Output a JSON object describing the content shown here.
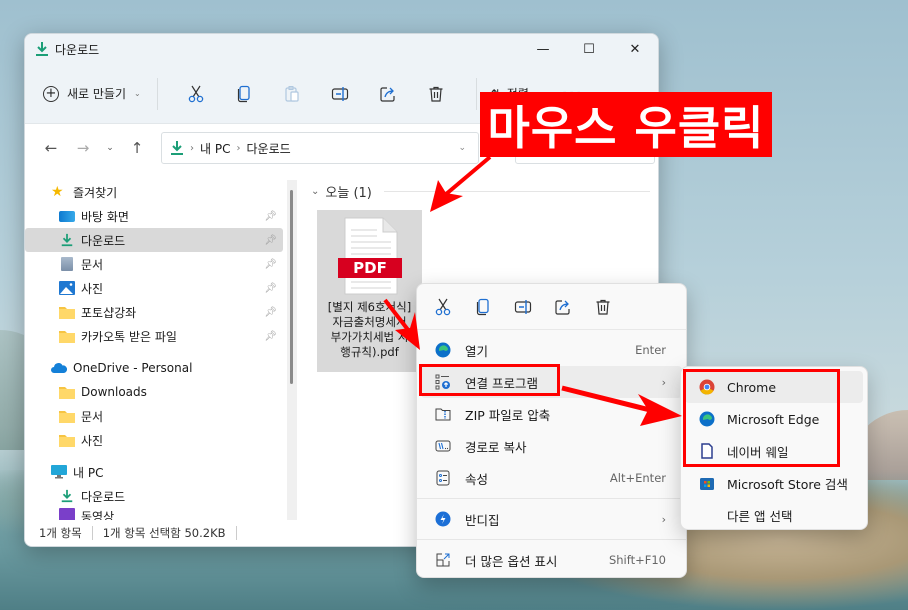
{
  "window": {
    "title": "다운로드",
    "controls": {
      "minimize": "—",
      "maximize": "☐",
      "close": "✕"
    }
  },
  "toolbar": {
    "new_label": "새로 만들기",
    "sort_label": "정렬",
    "more_label": "···",
    "icons": [
      "cut-icon",
      "copy-icon",
      "paste-icon",
      "rename-icon",
      "share-icon",
      "delete-icon"
    ]
  },
  "navbar": {
    "breadcrumb": [
      "내 PC",
      "다운로드"
    ],
    "separator": "›"
  },
  "sidebar": {
    "favorites_label": "즐겨찾기",
    "quick_access": [
      {
        "label": "바탕 화면",
        "icon": "desktop-icon",
        "pinned": true
      },
      {
        "label": "다운로드",
        "icon": "download-icon",
        "pinned": true,
        "selected": true
      },
      {
        "label": "문서",
        "icon": "document-icon",
        "pinned": true
      },
      {
        "label": "사진",
        "icon": "pictures-icon",
        "pinned": true
      },
      {
        "label": "포토샵강좌",
        "icon": "folder-icon",
        "pinned": true
      },
      {
        "label": "카카오톡 받은 파일",
        "icon": "folder-icon",
        "pinned": true
      }
    ],
    "onedrive_label": "OneDrive - Personal",
    "onedrive_items": [
      {
        "label": "Downloads",
        "icon": "folder-icon"
      },
      {
        "label": "문서",
        "icon": "folder-icon"
      },
      {
        "label": "사진",
        "icon": "folder-icon"
      }
    ],
    "pc_label": "내 PC",
    "pc_items": [
      {
        "label": "다운로드",
        "icon": "download-icon"
      },
      {
        "label": "동영상",
        "icon": "video-icon"
      }
    ]
  },
  "files": {
    "group_label": "오늘 (1)",
    "items": [
      {
        "name": "[별지 제6호서식] 자금출처명세서(부가가치세법 시행규칙).pdf",
        "display_lines": [
          "[별지 제6호서식]",
          "자금출처명세서",
          "부가가치세법 시",
          "행규칙).pdf"
        ],
        "badge": "PDF"
      }
    ]
  },
  "statusbar": {
    "item_count": "1개 항목",
    "selection": "1개 항목 선택함 50.2KB"
  },
  "context_menu": {
    "items": [
      {
        "label": "열기",
        "shortcut": "Enter",
        "icon": "edge-icon"
      },
      {
        "label": "연결 프로그램",
        "submenu": true,
        "icon": "open-with-icon",
        "highlighted": true
      },
      {
        "label": "ZIP 파일로 압축",
        "icon": "zip-icon"
      },
      {
        "label": "경로로 복사",
        "icon": "copy-path-icon"
      },
      {
        "label": "속성",
        "shortcut": "Alt+Enter",
        "icon": "properties-icon"
      },
      {
        "label": "반디집",
        "submenu": true,
        "icon": "bandizip-icon"
      },
      {
        "label": "더 많은 옵션 표시",
        "shortcut": "Shift+F10",
        "icon": "more-options-icon"
      }
    ],
    "arrow": "›"
  },
  "submenu": {
    "items": [
      {
        "label": "Chrome",
        "icon": "chrome-icon"
      },
      {
        "label": "Microsoft Edge",
        "icon": "edge-icon"
      },
      {
        "label": "네이버 웨일",
        "icon": "whale-file-icon"
      },
      {
        "label": "Microsoft Store 검색",
        "icon": "store-icon"
      },
      {
        "label": "다른 앱 선택",
        "icon": ""
      }
    ]
  },
  "annotation": {
    "label": "마우스 우클릭",
    "color": "#ff0000"
  },
  "colors": {
    "accent_teal": "#1b9e77",
    "pdf_red": "#d7001f",
    "annotation_red": "#ff0000"
  }
}
